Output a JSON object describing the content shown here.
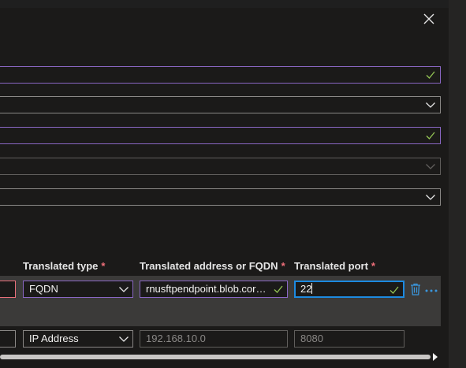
{
  "headers": {
    "translated_type": "Translated type",
    "translated_address": "Translated address or FQDN",
    "translated_port": "Translated port",
    "required_mark": "*"
  },
  "rows": [
    {
      "type": "FQDN",
      "address": "rnusftpendpoint.blob.core.windows.net",
      "port": "22"
    },
    {
      "type": "IP Address",
      "address_placeholder": "192.168.10.0",
      "port_placeholder": "8080"
    }
  ],
  "icons": {
    "close": "close-icon",
    "check": "checkmark-icon",
    "chevron": "chevron-down-icon",
    "delete": "trash-icon",
    "more": "more-icon"
  },
  "colors": {
    "accent_purple": "#8a67c4",
    "focus_blue": "#1d8ae0",
    "valid_green": "#92c353",
    "required_red": "#f1707b"
  }
}
